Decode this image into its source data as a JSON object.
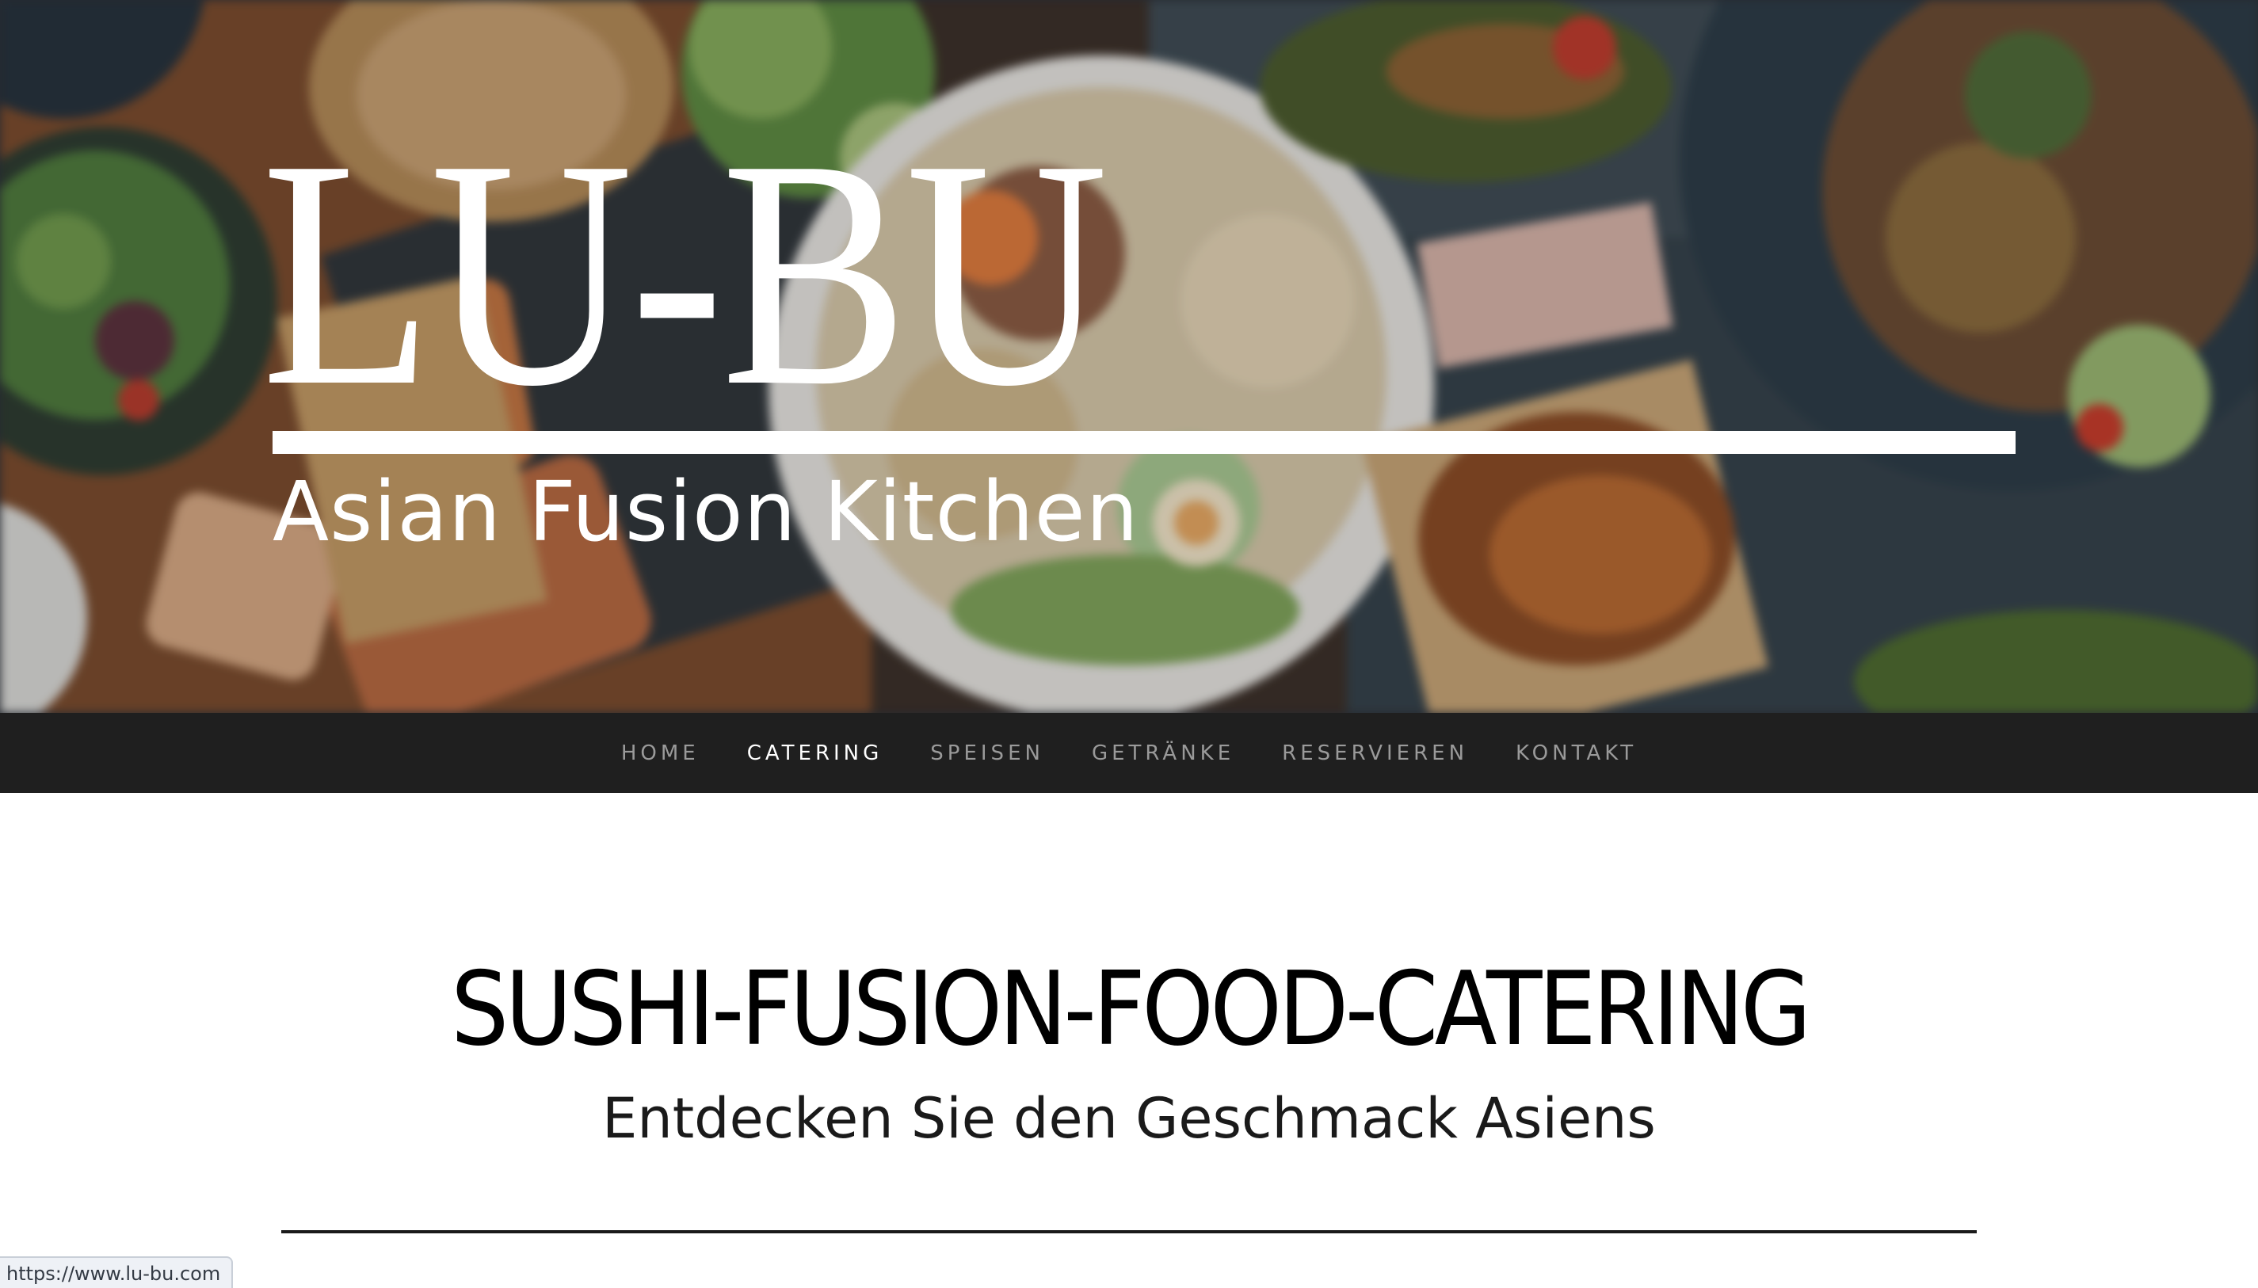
{
  "brand": {
    "logo_text": "LU-BU",
    "tagline": "Asian Fusion Kitchen"
  },
  "nav": {
    "items": [
      {
        "label": "HOME",
        "active": false
      },
      {
        "label": "CATERING",
        "active": true
      },
      {
        "label": "SPEISEN",
        "active": false
      },
      {
        "label": "GETRÄNKE",
        "active": false
      },
      {
        "label": "RESERVIEREN",
        "active": false
      },
      {
        "label": "KONTAKT",
        "active": false
      }
    ]
  },
  "main": {
    "heading": "SUSHI-FUSION-FOOD-CATERING",
    "subheading": "Entdecken Sie den Geschmack Asiens"
  },
  "status_bar": {
    "url": "https://www.lu-bu.com"
  },
  "colors": {
    "nav_background": "#1f1f1f",
    "nav_text": "#9a9a9a",
    "nav_active_text": "#ffffff",
    "heading_text": "#000000",
    "page_background": "#ffffff"
  }
}
